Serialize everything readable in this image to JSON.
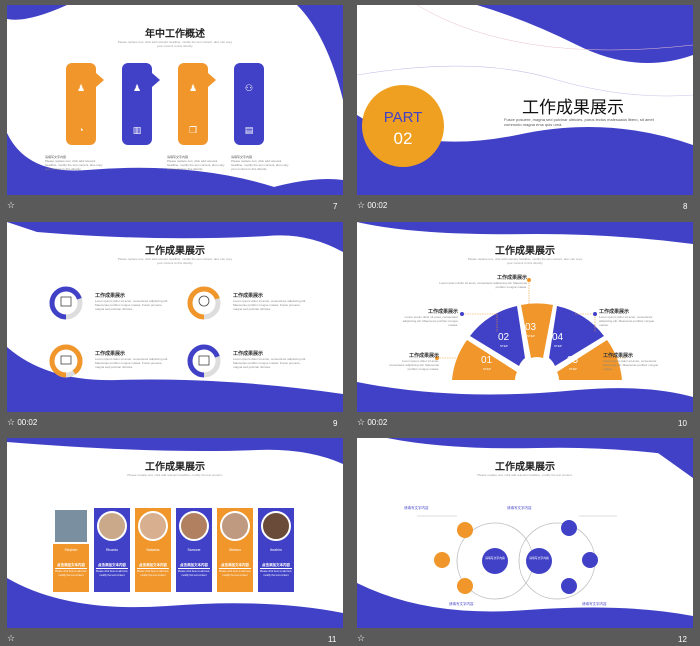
{
  "slides": [
    {
      "number": "7",
      "time": "",
      "title": "年中工作概述",
      "subtitle": "Please replace text, click add relevant headline, modify the text content, also can copy your content to this directly.",
      "captions": [
        {
          "label": "请填写文字内容",
          "text": "Please replace text, click add relevant headline, modify the text content, also copy your content to this directly."
        },
        {
          "label": "请填写文字内容",
          "text": "Please replace text, click add relevant headline, modify the text content, also copy your content to this directly."
        },
        {
          "label": "请填写文字内容",
          "text": "Please replace text, click add relevant headline, modify the text content, also copy your content to this directly."
        }
      ]
    },
    {
      "number": "8",
      "time": "00:02",
      "part_label": "PART",
      "part_number": "02",
      "title": "工作成果展示",
      "subtitle": "Fusce posuere, magna sed pulvinar ultricies, purus lectus malesuada libero, sit amet commodo magna eros quis urna."
    },
    {
      "number": "9",
      "time": "00:02",
      "title": "工作成果展示",
      "subtitle": "Please replace text, click add relevant headline, modify the text content, also can copy your content to this directly.",
      "items": [
        {
          "label": "工作成果展示",
          "pct": "70%",
          "text": "Lorem ipsum dolor sit amet, consectetur adipiscing elit. Maecenas porttitor congue massa. Fusce posuere, magna sed pulvinar ultricies."
        },
        {
          "label": "工作成果展示",
          "pct": "70%",
          "text": "Lorem ipsum dolor sit amet, consectetur adipiscing elit. Maecenas porttitor congue massa. Fusce posuere, magna sed pulvinar ultricies."
        },
        {
          "label": "工作成果展示",
          "pct": "90%",
          "text": "Lorem ipsum dolor sit amet, consectetur adipiscing elit. Maecenas porttitor congue massa. Fusce posuere, magna sed pulvinar ultricies."
        },
        {
          "label": "工作成果展示",
          "pct": "70%",
          "text": "Lorem ipsum dolor sit amet, consectetur adipiscing elit. Maecenas porttitor congue massa. Fusce posuere, magna sed pulvinar ultricies."
        }
      ]
    },
    {
      "number": "10",
      "time": "00:02",
      "title": "工作成果展示",
      "subtitle": "Please replace text, click add relevant headline, modify the text content, also can copy your content to this directly.",
      "steps": [
        {
          "num": "01",
          "word": "STEP"
        },
        {
          "num": "02",
          "word": "STEP"
        },
        {
          "num": "03",
          "word": "STEP"
        },
        {
          "num": "04",
          "word": "STEP"
        },
        {
          "num": "05",
          "word": "STEP"
        }
      ],
      "labels": [
        {
          "label": "工作成果展示",
          "text": "Lorem ipsum dolor sit amet, consectetur adipiscing elit. Maecenas porttitor congue massa."
        },
        {
          "label": "工作成果展示",
          "text": "Lorem ipsum dolor sit amet, consectetur adipiscing elit. Maecenas porttitor congue massa."
        },
        {
          "label": "工作成果展示",
          "text": "Lorem ipsum dolor sit amet, consectetur adipiscing elit. Maecenas porttitor congue massa."
        },
        {
          "label": "工作成果展示",
          "text": "Lorem ipsum dolor sit amet, consectetur adipiscing elit. Maecenas porttitor congue massa."
        },
        {
          "label": "工作成果展示",
          "text": "Lorem ipsum dolor sit amet, consectetur adipiscing elit. Maecenas porttitor congue massa."
        }
      ]
    },
    {
      "number": "11",
      "time": "",
      "title": "工作成果展示",
      "subtitle": "Please replace text, click add relevant headline, modify the text content.",
      "people": [
        {
          "name": "Stephen",
          "role": "点击添加文本内容",
          "desc": "Please click here to add text, modify the text content"
        },
        {
          "name": "Ricardo",
          "role": "点击添加文本内容",
          "desc": "Please click here to add text, modify the text content"
        },
        {
          "name": "Natasha",
          "role": "点击添加文本内容",
          "desc": "Please click here to add text, modify the text content"
        },
        {
          "name": "Samone",
          "role": "点击添加文本内容",
          "desc": "Please click here to add text, modify the text content"
        },
        {
          "name": "Stefano",
          "role": "点击添加文本内容",
          "desc": "Please click here to add text, modify the text content"
        },
        {
          "name": "Ibrahim",
          "role": "点击添加文本内容",
          "desc": "Please click here to add text, modify the text content"
        }
      ]
    },
    {
      "number": "12",
      "time": "",
      "title": "工作成果展示",
      "subtitle": "Please replace text, click add relevant headline, modify the text content.",
      "center": [
        "请填写文字内容",
        "请填写文字内容"
      ],
      "labels": [
        "请填写文字内容",
        "请填写文字内容",
        "请填写文字内容",
        "请填写文字内容"
      ]
    }
  ],
  "colors": {
    "blue": "#4141c8",
    "orange": "#f0962a",
    "panel": "#5a5a5a"
  }
}
